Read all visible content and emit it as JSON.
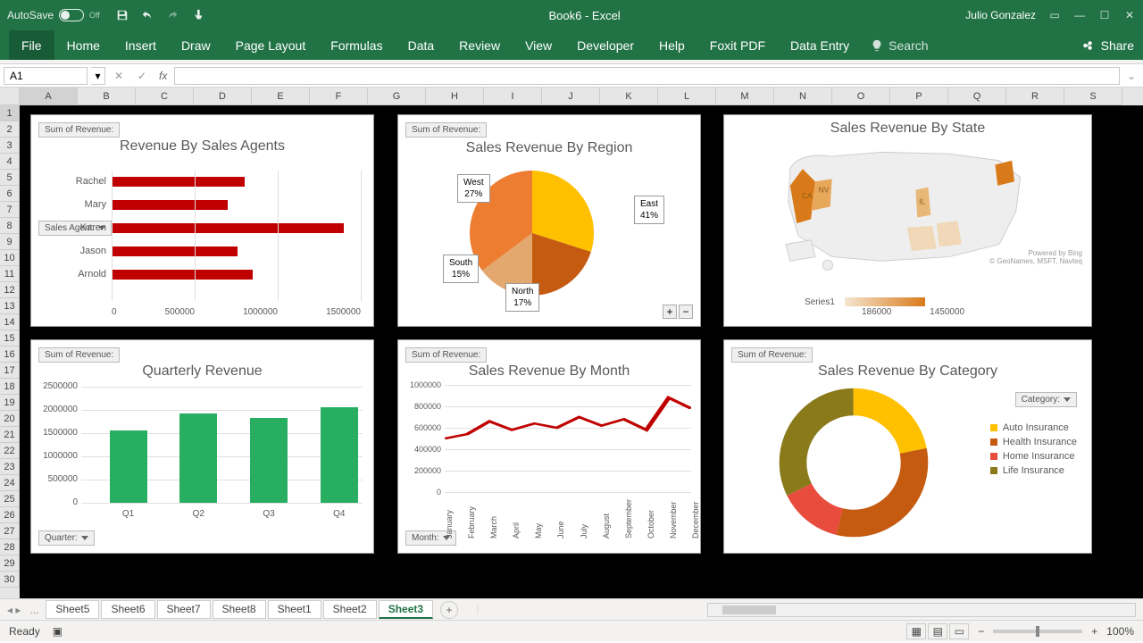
{
  "titlebar": {
    "autosave": "AutoSave",
    "autosave_state": "Off",
    "title": "Book6  -  Excel",
    "user": "Julio Gonzalez"
  },
  "ribbon": {
    "tabs": [
      "File",
      "Home",
      "Insert",
      "Draw",
      "Page Layout",
      "Formulas",
      "Data",
      "Review",
      "View",
      "Developer",
      "Help",
      "Foxit PDF",
      "Data Entry"
    ],
    "search": "Search",
    "share": "Share"
  },
  "formula": {
    "cell": "A1",
    "fx": "fx"
  },
  "cols": [
    "A",
    "B",
    "C",
    "D",
    "E",
    "F",
    "G",
    "H",
    "I",
    "J",
    "K",
    "L",
    "M",
    "N",
    "O",
    "P",
    "Q",
    "R",
    "S"
  ],
  "chart_data": [
    {
      "id": "agents",
      "type": "bar",
      "orientation": "h",
      "title": "Revenue By Sales Agents",
      "sor": "Sum of Revenue:",
      "slicer": "Sales Agent:",
      "categories": [
        "Rachel",
        "Mary",
        "Karen",
        "Jason",
        "Arnold"
      ],
      "values": [
        800000,
        700000,
        1400000,
        760000,
        850000
      ],
      "xticks": [
        "0",
        "500000",
        "1000000",
        "1500000"
      ],
      "xlim": [
        0,
        1500000
      ],
      "color": "#c00000"
    },
    {
      "id": "region",
      "type": "pie",
      "title": "Sales Revenue By Region",
      "sor": "Sum of Revenue:",
      "series": [
        {
          "name": "East",
          "value": 41,
          "color": "#ffc000"
        },
        {
          "name": "West",
          "value": 27,
          "color": "#ed7d31"
        },
        {
          "name": "North",
          "value": 17,
          "color": "#c55a11"
        },
        {
          "name": "South",
          "value": 15,
          "color": "#e2a86e"
        }
      ]
    },
    {
      "id": "state",
      "type": "map",
      "title": "Sales Revenue By State",
      "legend_series": "Series1",
      "legend_min": "186000",
      "legend_max": "1450000",
      "credit1": "Powered by Bing",
      "credit2": "© GeoNames, MSFT, Navteq",
      "highlight": [
        "CA",
        "NV",
        "IL"
      ]
    },
    {
      "id": "quarter",
      "type": "bar",
      "title": "Quarterly Revenue",
      "sor": "Sum of Revenue:",
      "slicer": "Quarter:",
      "categories": [
        "Q1",
        "Q2",
        "Q3",
        "Q4"
      ],
      "values": [
        1550000,
        1920000,
        1830000,
        2050000
      ],
      "yticks": [
        "0",
        "500000",
        "1000000",
        "1500000",
        "2000000",
        "2500000"
      ],
      "ylim": [
        0,
        2500000
      ],
      "color": "#27ae60"
    },
    {
      "id": "month",
      "type": "line",
      "title": "Sales Revenue By Month",
      "sor": "Sum of Revenue:",
      "slicer": "Month:",
      "categories": [
        "January",
        "February",
        "March",
        "April",
        "May",
        "June",
        "July",
        "August",
        "September",
        "October",
        "November",
        "December"
      ],
      "values": [
        500000,
        540000,
        660000,
        580000,
        640000,
        600000,
        700000,
        620000,
        680000,
        580000,
        880000,
        780000
      ],
      "yticks": [
        "0",
        "200000",
        "400000",
        "600000",
        "800000",
        "1000000"
      ],
      "ylim": [
        0,
        1000000
      ],
      "color": "#c00000"
    },
    {
      "id": "category",
      "type": "donut",
      "title": "Sales Revenue By Category",
      "sor": "Sum of Revenue:",
      "slicer": "Category:",
      "series": [
        {
          "name": "Auto Insurance",
          "value": 22,
          "color": "#ffc000"
        },
        {
          "name": "Health Insurance",
          "value": 32,
          "color": "#c55a11"
        },
        {
          "name": "Home Insurance",
          "value": 14,
          "color": "#e74c3c"
        },
        {
          "name": "Life Insurance",
          "value": 32,
          "color": "#8a7a1a"
        }
      ]
    }
  ],
  "sheets": {
    "tabs": [
      "Sheet5",
      "Sheet6",
      "Sheet7",
      "Sheet8",
      "Sheet1",
      "Sheet2",
      "Sheet3"
    ],
    "active": "Sheet3",
    "more": "..."
  },
  "status": {
    "ready": "Ready",
    "zoom": "100%"
  }
}
